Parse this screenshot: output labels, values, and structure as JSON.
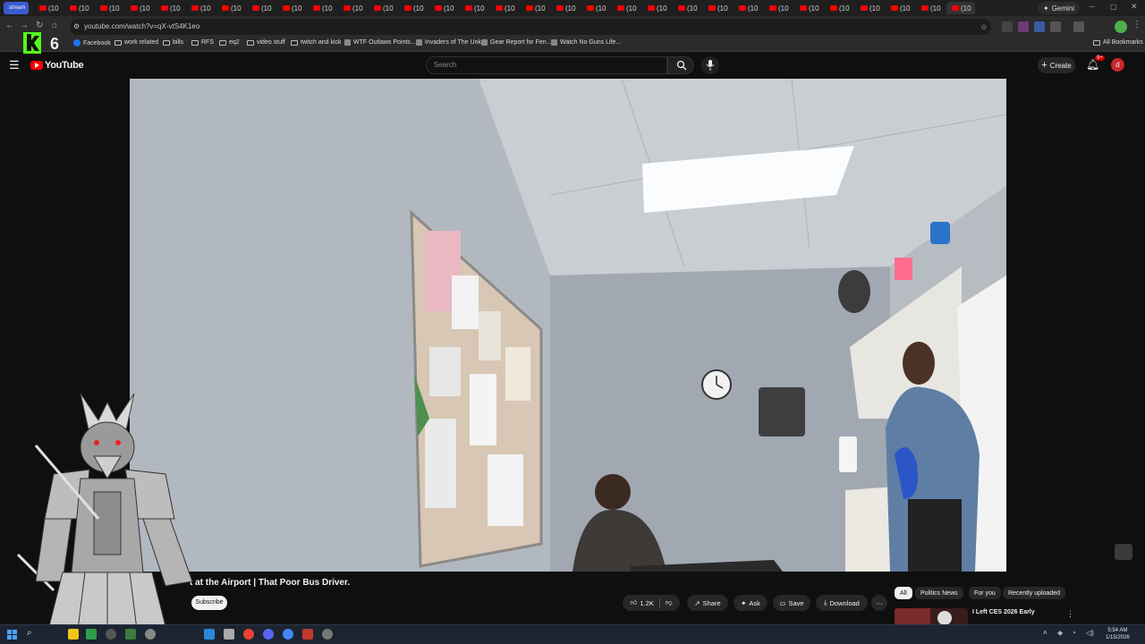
{
  "browser": {
    "tab_label": "(10",
    "tab_count": 32,
    "first_tab_label": "stream",
    "gemini_label": "Gemini",
    "url": "youtube.com/watch?v=qX-vtS4K1eo",
    "bookmarks": [
      "Facebook",
      "work related",
      "bills",
      "RFS",
      "eq2",
      "video stuff",
      "twitch and kick",
      "WTF Outlaws Points...",
      "Invaders of The Unk...",
      "Gear Report for Fen...",
      "Watch No Guns Life..."
    ],
    "all_bookmarks": "All Bookmarks"
  },
  "youtube": {
    "logo_text": "YouTube",
    "search_placeholder": "Search",
    "create_label": "Create",
    "notif_count": "9+",
    "avatar_letter": "d"
  },
  "video": {
    "title": "t at the Airport | That Poor Bus Driver.",
    "subscribe_label": "Subscribe"
  },
  "actions": {
    "likes": "1.2K",
    "share": "Share",
    "ask": "Ask",
    "save": "Save",
    "download": "Download"
  },
  "chips": [
    "All",
    "Politics News",
    "For you",
    "Recently uploaded"
  ],
  "recommendation": {
    "title": "I Left CES 2026 Early"
  },
  "overlay": {
    "kick_number": "6",
    "kick_letter": "K"
  },
  "taskbar": {
    "time": "5:54 AM",
    "date": "1/15/2026"
  },
  "colors": {
    "youtube_red": "#ff0000",
    "kick_green": "#53fc18",
    "background": "#0f0f0f"
  }
}
